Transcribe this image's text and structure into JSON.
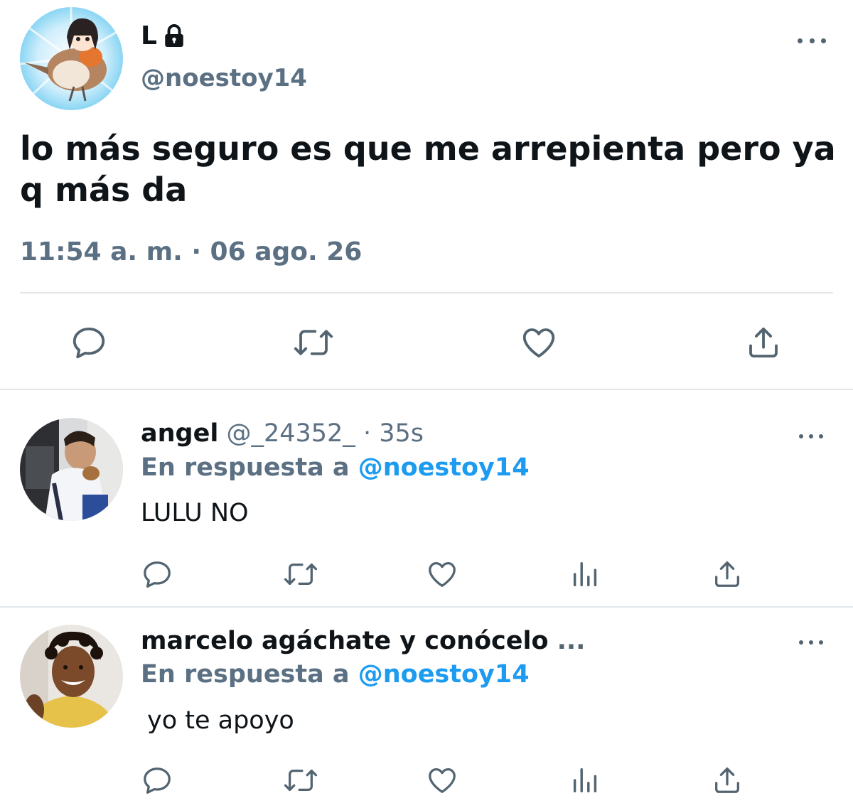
{
  "main_tweet": {
    "display_name": "L",
    "handle": "@noestoy14",
    "text": "lo más seguro es que me arrepienta pero ya q más da",
    "timestamp": "11:54 a. m. · 06 ago. 26",
    "icons": [
      "lock-icon",
      "more-icon",
      "reply-icon",
      "retweet-icon",
      "like-icon",
      "share-icon"
    ]
  },
  "replies": [
    {
      "display_name": "angel",
      "handle": "@_24352_",
      "time": "· 35s",
      "reply_prefix": "En respuesta a",
      "reply_mention": "@noestoy14",
      "text": "LULU NO"
    },
    {
      "display_name": "marcelo agáchate y conócelo",
      "truncation": "...",
      "reply_prefix": "En respuesta a",
      "reply_mention": "@noestoy14",
      "text": "yo te apoyo"
    }
  ],
  "colors": {
    "text": "#0f1419",
    "secondary": "#5b7083",
    "accent": "#1d9bf0",
    "divider": "#e3e7ea"
  }
}
